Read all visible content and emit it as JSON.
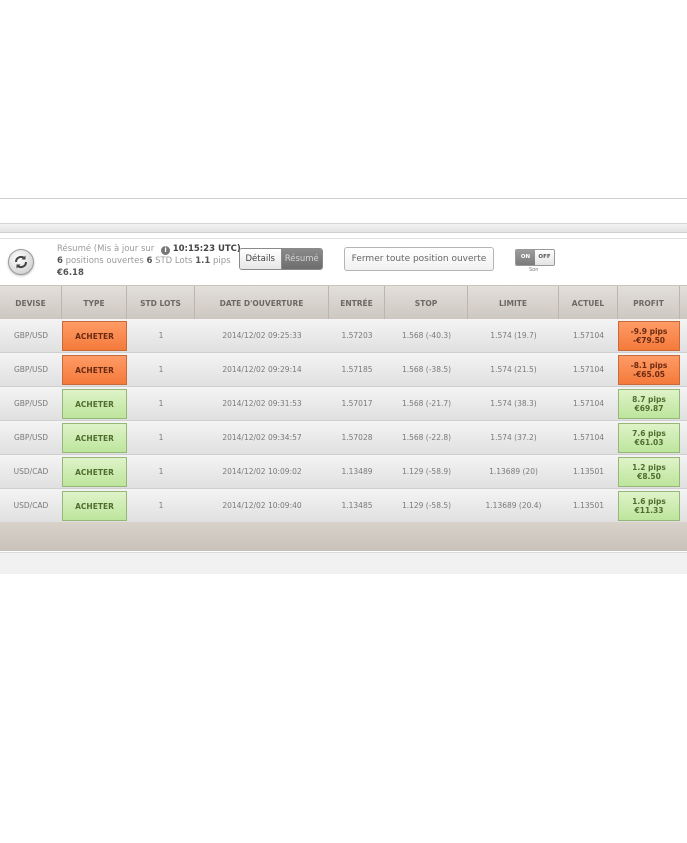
{
  "toolbar": {
    "summary_label": "Résumé",
    "updated_prefix": "(Mis à jour sur",
    "update_time": "10:15:23 UTC)",
    "positions_count": "6",
    "positions_text": "positions ouvertes",
    "std_count": "6",
    "std_text": "STD Lots",
    "pips_total": "1.1",
    "pips_text": "pips",
    "total_profit": "€6.18",
    "view_details": "Détails",
    "view_summary": "Résumé",
    "close_all": "Fermer toute position ouverte",
    "sound_on": "ON",
    "sound_off": "OFF",
    "sound_label": "Son"
  },
  "table": {
    "headers": [
      "DEVISE",
      "TYPE",
      "STD LOTS",
      "DATE D'OUVERTURE",
      "ENTRÉE",
      "STOP",
      "LIMITE",
      "ACTUEL",
      "PROFIT"
    ],
    "rows": [
      {
        "pair": "GBP/USD",
        "type": "ACHETER",
        "type_status": "loss",
        "lots": "1",
        "date": "2014/12/02 09:25:33",
        "entry": "1.57203",
        "stop": "1.568 (-40.3)",
        "limit": "1.574 (19.7)",
        "current": "1.57104",
        "profit_pips": "-9.9 pips",
        "profit_eur": "-€79.50"
      },
      {
        "pair": "GBP/USD",
        "type": "ACHETER",
        "type_status": "loss",
        "lots": "1",
        "date": "2014/12/02 09:29:14",
        "entry": "1.57185",
        "stop": "1.568 (-38.5)",
        "limit": "1.574 (21.5)",
        "current": "1.57104",
        "profit_pips": "-8.1 pips",
        "profit_eur": "-€65.05"
      },
      {
        "pair": "GBP/USD",
        "type": "ACHETER",
        "type_status": "gain",
        "lots": "1",
        "date": "2014/12/02 09:31:53",
        "entry": "1.57017",
        "stop": "1.568 (-21.7)",
        "limit": "1.574 (38.3)",
        "current": "1.57104",
        "profit_pips": "8.7 pips",
        "profit_eur": "€69.87"
      },
      {
        "pair": "GBP/USD",
        "type": "ACHETER",
        "type_status": "gain",
        "lots": "1",
        "date": "2014/12/02 09:34:57",
        "entry": "1.57028",
        "stop": "1.568 (-22.8)",
        "limit": "1.574 (37.2)",
        "current": "1.57104",
        "profit_pips": "7.6 pips",
        "profit_eur": "€61.03"
      },
      {
        "pair": "USD/CAD",
        "type": "ACHETER",
        "type_status": "gain",
        "lots": "1",
        "date": "2014/12/02 10:09:02",
        "entry": "1.13489",
        "stop": "1.129 (-58.9)",
        "limit": "1.13689 (20)",
        "current": "1.13501",
        "profit_pips": "1.2 pips",
        "profit_eur": "€8.50"
      },
      {
        "pair": "USD/CAD",
        "type": "ACHETER",
        "type_status": "gain",
        "lots": "1",
        "date": "2014/12/02 10:09:40",
        "entry": "1.13485",
        "stop": "1.129 (-58.5)",
        "limit": "1.13689 (20.4)",
        "current": "1.13501",
        "profit_pips": "1.6 pips",
        "profit_eur": "€11.33"
      }
    ]
  },
  "colors": {
    "loss": "#f47a3b",
    "gain": "#bde59c"
  }
}
